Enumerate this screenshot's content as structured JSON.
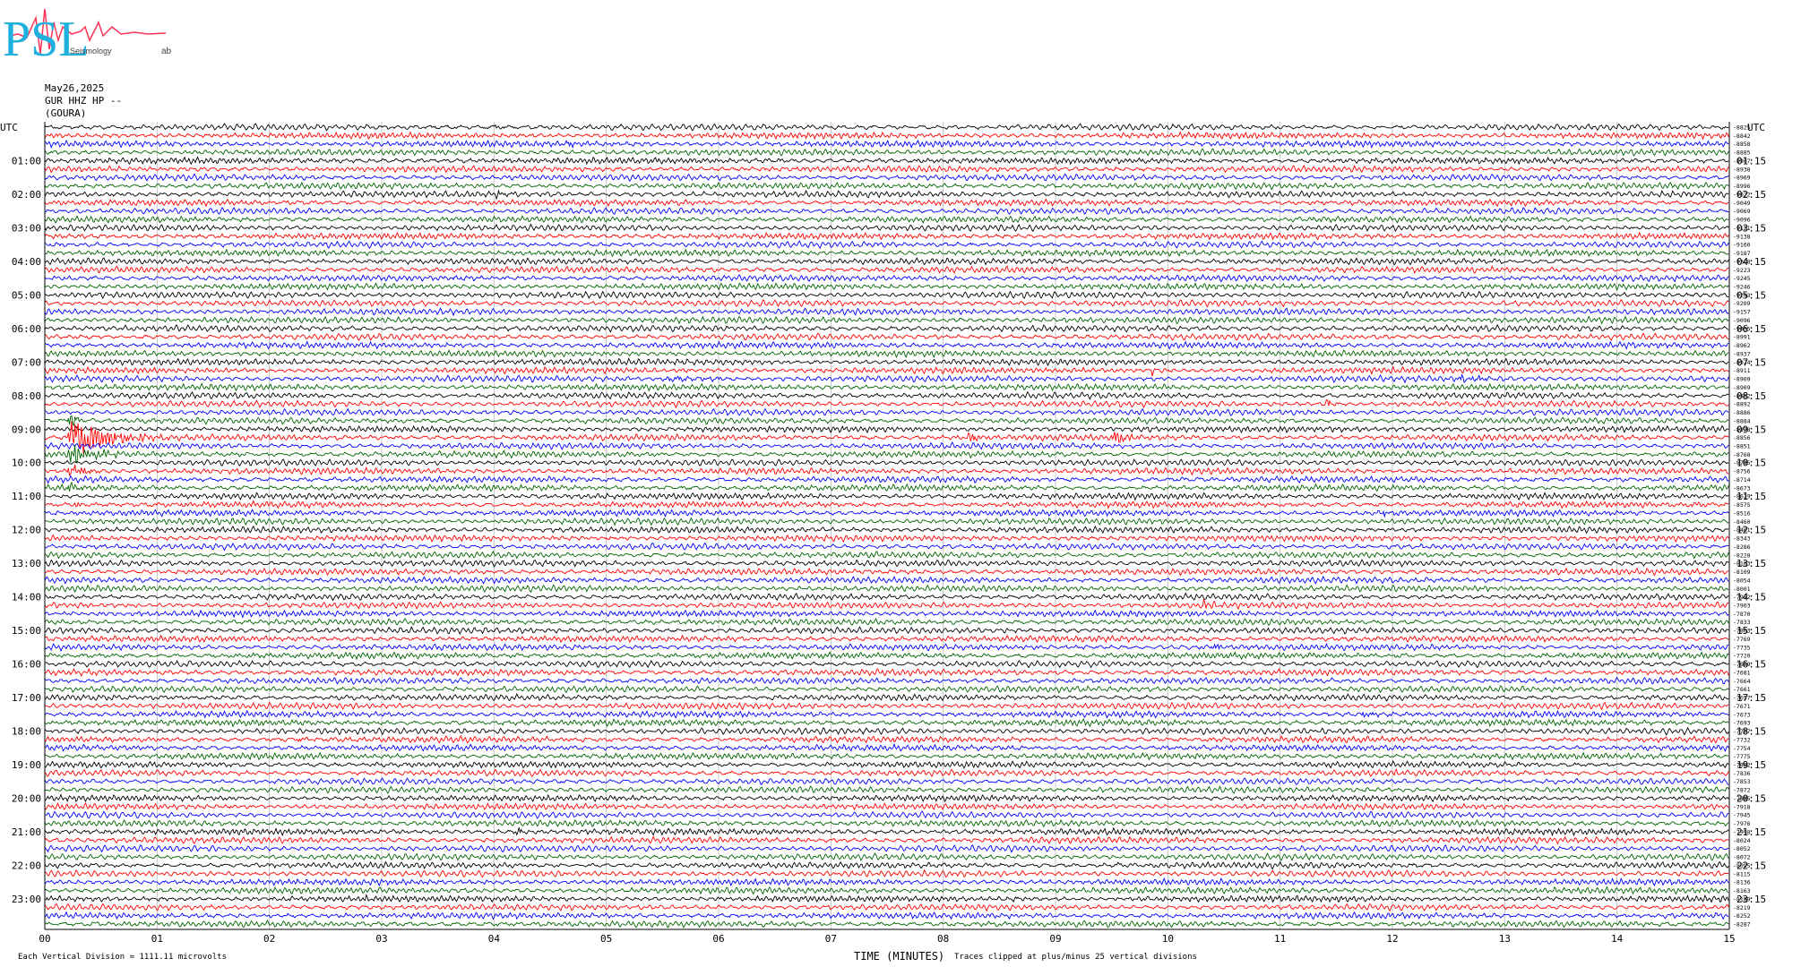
{
  "logo": {
    "text": "PSL",
    "sub": "Seismology",
    "lab": "ab"
  },
  "header": {
    "date": "May26,2025",
    "channel": "GUR HHZ HP --",
    "station": "(GOURA)"
  },
  "footer": {
    "scale": "Each Vertical Division = 1111.11 microvolts",
    "xlabel": "TIME (MINUTES)",
    "clip": "Traces clipped at plus/minus 25 vertical divisions"
  },
  "colors": {
    "trace": [
      "#000000",
      "#ff0000",
      "#0000ff",
      "#006400"
    ]
  },
  "chart_data": {
    "type": "line",
    "title": "",
    "xlabel": "TIME (MINUTES)",
    "ylabel": "UTC",
    "xlim": [
      0,
      15
    ],
    "x_ticks": [
      "00",
      "01",
      "02",
      "03",
      "04",
      "05",
      "06",
      "07",
      "08",
      "09",
      "10",
      "11",
      "12",
      "13",
      "14",
      "15"
    ],
    "left_axis_label": "UTC",
    "right_axis_label": "UTC",
    "left_labels": [
      "01:00",
      "02:00",
      "03:00",
      "04:00",
      "05:00",
      "06:00",
      "07:00",
      "08:00",
      "09:00",
      "10:00",
      "11:00",
      "12:00",
      "13:00",
      "14:00",
      "15:00",
      "16:00",
      "17:00",
      "18:00",
      "19:00",
      "20:00",
      "21:00",
      "22:00",
      "23:00"
    ],
    "right_labels": [
      "01:15",
      "02:15",
      "03:15",
      "04:15",
      "05:15",
      "06:15",
      "07:15",
      "08:15",
      "09:15",
      "10:15",
      "11:15",
      "12:15",
      "13:15",
      "14:15",
      "15:15",
      "16:15",
      "17:15",
      "18:15",
      "19:15",
      "20:15",
      "21:15",
      "22:15",
      "23:15"
    ],
    "trace_count": 96,
    "trace_offsets": [
      "-8825",
      "-8842",
      "-8858",
      "-8885",
      "-8907",
      "-8938",
      "-8969",
      "-8996",
      "-9022",
      "-9049",
      "-9069",
      "-9096",
      "-9121",
      "-9138",
      "-9160",
      "-9187",
      "-9208",
      "-9223",
      "-9245",
      "-9246",
      "-9243",
      "-9209",
      "-9157",
      "-9096",
      "-9035",
      "-8991",
      "-8962",
      "-8937",
      "-8924",
      "-8911",
      "-8909",
      "-8909",
      "-8902",
      "-8892",
      "-8886",
      "-8884",
      "-8878",
      "-8856",
      "-8851",
      "-8768",
      "-8795",
      "-8756",
      "-8714",
      "-8673",
      "-8629",
      "-8575",
      "-8516",
      "-8460",
      "-8401",
      "-8343",
      "-8286",
      "-8228",
      "-8163",
      "-8109",
      "-8054",
      "-8001",
      "-7952",
      "-7903",
      "-7870",
      "-7833",
      "-7803",
      "-7769",
      "-7735",
      "-7720",
      "-7699",
      "-7681",
      "-7664",
      "-7661",
      "-7657",
      "-7671",
      "-7673",
      "-7693",
      "-7707",
      "-7732",
      "-7754",
      "-7775",
      "-7802",
      "-7836",
      "-7853",
      "-7872",
      "-7895",
      "-7918",
      "-7945",
      "-7976",
      "-7998",
      "-8024",
      "-8052",
      "-8072",
      "-8095",
      "-8115",
      "-8136",
      "-8163",
      "-8189",
      "-8219",
      "-8252",
      "-8287"
    ],
    "events": [
      {
        "trace": 37,
        "minute": 0.2,
        "duration": 0.9,
        "amplitude": 30
      },
      {
        "trace": 39,
        "minute": 0.2,
        "duration": 0.6,
        "amplitude": 14
      },
      {
        "trace": 41,
        "minute": 0.2,
        "duration": 0.4,
        "amplitude": 9
      },
      {
        "trace": 43,
        "minute": 0.2,
        "duration": 0.3,
        "amplitude": 7
      },
      {
        "trace": 45,
        "minute": 0.25,
        "duration": 0.2,
        "amplitude": 6
      },
      {
        "trace": 35,
        "minute": 0.2,
        "duration": 0.3,
        "amplitude": 10
      },
      {
        "trace": 37,
        "minute": 8.2,
        "duration": 0.3,
        "amplitude": 7
      },
      {
        "trace": 37,
        "minute": 9.5,
        "duration": 0.4,
        "amplitude": 8
      },
      {
        "trace": 33,
        "minute": 11.4,
        "duration": 0.15,
        "amplitude": 8
      },
      {
        "trace": 29,
        "minute": 9.85,
        "duration": 0.15,
        "amplitude": 5
      },
      {
        "trace": 30,
        "minute": 5.5,
        "duration": 1.2,
        "amplitude": 3
      },
      {
        "trace": 30,
        "minute": 12.5,
        "duration": 1.3,
        "amplitude": 3
      },
      {
        "trace": 57,
        "minute": 10.3,
        "duration": 0.4,
        "amplitude": 5
      },
      {
        "trace": 62,
        "minute": 10.4,
        "duration": 0.2,
        "amplitude": 5
      },
      {
        "trace": 73,
        "minute": 2.25,
        "duration": 0.05,
        "amplitude": 12
      },
      {
        "trace": 77,
        "minute": 12.0,
        "duration": 0.2,
        "amplitude": 4
      },
      {
        "trace": 84,
        "minute": 4.2,
        "duration": 0.1,
        "amplitude": 7
      },
      {
        "trace": 85,
        "minute": 3.3,
        "duration": 0.05,
        "amplitude": 6
      },
      {
        "trace": 70,
        "minute": 11.7,
        "duration": 0.6,
        "amplitude": 4
      },
      {
        "trace": 85,
        "minute": 5.4,
        "duration": 0.05,
        "amplitude": 5
      },
      {
        "trace": 88,
        "minute": 9.55,
        "duration": 0.1,
        "amplitude": 4
      },
      {
        "trace": 92,
        "minute": 8.6,
        "duration": 0.2,
        "amplitude": 4
      },
      {
        "trace": 92,
        "minute": 2.85,
        "duration": 0.15,
        "amplitude": 3
      },
      {
        "trace": 46,
        "minute": 11.9,
        "duration": 0.2,
        "amplitude": 4
      },
      {
        "trace": 56,
        "minute": 2.2,
        "duration": 0.1,
        "amplitude": 4
      },
      {
        "trace": 8,
        "minute": 4.0,
        "duration": 0.5,
        "amplitude": 4
      },
      {
        "trace": 0,
        "minute": 4.0,
        "duration": 0.2,
        "amplitude": 3
      },
      {
        "trace": 2,
        "minute": 4.65,
        "duration": 0.15,
        "amplitude": 4
      }
    ]
  }
}
